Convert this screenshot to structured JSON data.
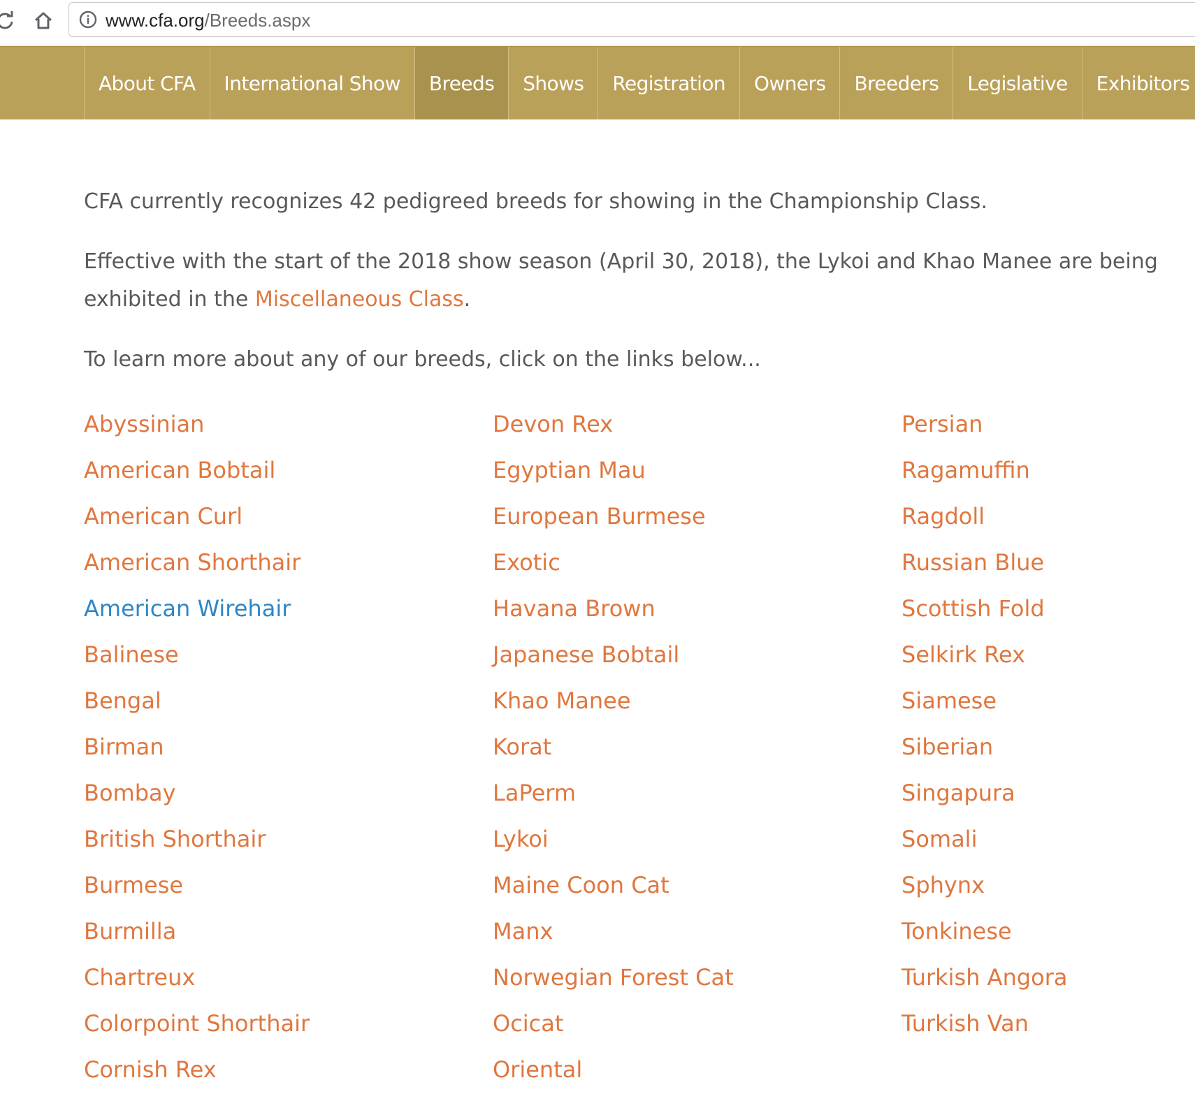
{
  "browser": {
    "url_host": "www.cfa.org",
    "url_path": "/Breeds.aspx",
    "reload_icon": "reload-icon",
    "home_icon": "home-icon",
    "info_icon": "info-icon"
  },
  "nav": {
    "items": [
      {
        "label": "About CFA",
        "active": false
      },
      {
        "label": "International Show",
        "active": false
      },
      {
        "label": "Breeds",
        "active": true
      },
      {
        "label": "Shows",
        "active": false
      },
      {
        "label": "Registration",
        "active": false
      },
      {
        "label": "Owners",
        "active": false
      },
      {
        "label": "Breeders",
        "active": false
      },
      {
        "label": "Legislative",
        "active": false
      },
      {
        "label": "Exhibitors",
        "active": false
      }
    ]
  },
  "content": {
    "intro": "CFA currently recognizes 42 pedigreed breeds for showing in the Championship Class.",
    "effective_prefix": "Effective with the start of the 2018 show season (April 30, 2018), the Lykoi and Khao Manee are being exhibited in the",
    "effective_link": "Miscellaneous Class",
    "effective_suffix": ".",
    "learn_more": "To learn more about any of our breeds, click on the links below..."
  },
  "breeds": {
    "column1": [
      "Abyssinian",
      "American Bobtail",
      "American Curl",
      "American Shorthair",
      "American Wirehair",
      "Balinese",
      "Bengal",
      "Birman",
      "Bombay",
      "British Shorthair",
      "Burmese",
      "Burmilla",
      "Chartreux",
      "Colorpoint Shorthair",
      "Cornish Rex"
    ],
    "column2": [
      "Devon Rex",
      "Egyptian Mau",
      "European Burmese",
      "Exotic",
      "Havana Brown",
      "Japanese Bobtail",
      "Khao Manee",
      "Korat",
      "LaPerm",
      "Lykoi",
      "Maine Coon Cat",
      "Manx",
      "Norwegian Forest Cat",
      "Ocicat",
      "Oriental"
    ],
    "column3": [
      "Persian",
      "Ragamuffin",
      "Ragdoll",
      "Russian Blue",
      "Scottish Fold",
      "Selkirk Rex",
      "Siamese",
      "Siberian",
      "Singapura",
      "Somali",
      "Sphynx",
      "Tonkinese",
      "Turkish Angora",
      "Turkish Van"
    ],
    "visited": [
      "American Wirehair"
    ]
  },
  "colors": {
    "nav_bg": "#baa15a",
    "nav_active_bg": "#a9924d",
    "link": "#e0773f",
    "link_visited": "#2f86c6",
    "body_text": "#595959"
  }
}
